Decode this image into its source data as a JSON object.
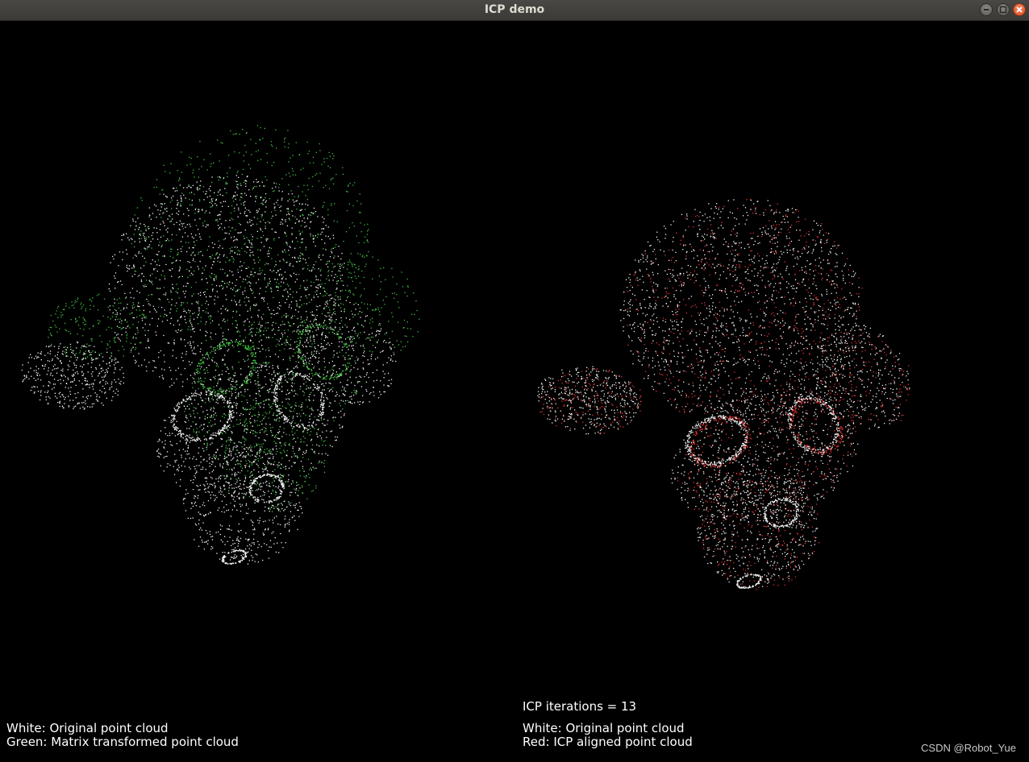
{
  "window": {
    "title": "ICP demo",
    "controls": [
      "minimize",
      "maximize",
      "close"
    ]
  },
  "viewports": {
    "left": {
      "legend_line1": "White: Original point cloud",
      "legend_line2": "Green: Matrix transformed point cloud",
      "cloud_colors": {
        "original": "#ffffff",
        "transformed": "#3fbf3f"
      }
    },
    "right": {
      "iterations_label": "ICP iterations = 13",
      "legend_line1": "White: Original point cloud",
      "legend_line2": "Red: ICP aligned point cloud",
      "cloud_colors": {
        "original": "#ffffff",
        "aligned": "#e03030"
      }
    }
  },
  "watermark": "CSDN @Robot_Yue"
}
